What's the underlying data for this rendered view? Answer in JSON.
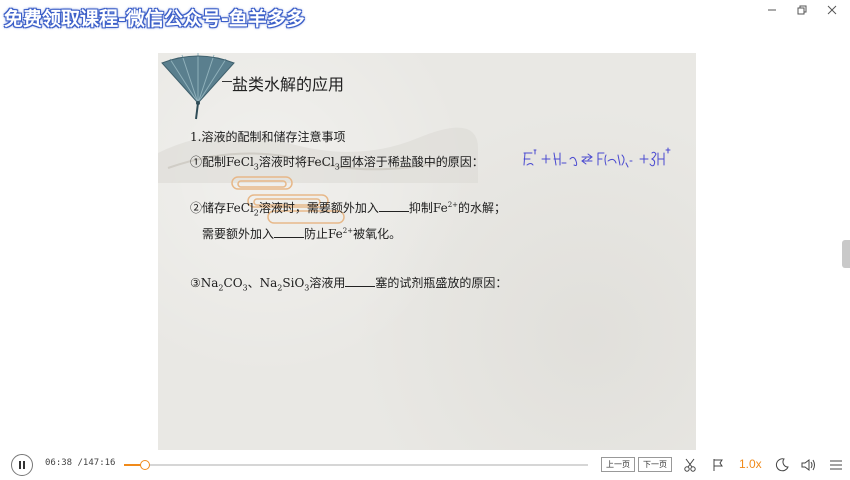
{
  "watermark": "免费领取课程-微信公众号-鱼羊多多",
  "slide": {
    "title": "盐类水解的应用",
    "section": "1.溶液的配制和储存注意事项",
    "item1": {
      "prefix": "①配制FeCl",
      "sub1": "3",
      "mid": "溶液时将FeCl",
      "sub2": "3",
      "suffix": "固体溶于稀盐酸中的原因："
    },
    "item2": {
      "prefix": "②储存FeCl",
      "sub1": "2",
      "mid": "溶液时，需要额外加入",
      "after_blank": "抑制Fe",
      "sup": "2+",
      "suffix": "的水解；"
    },
    "item2b": {
      "prefix": "需要额外加入",
      "after_blank": "防止Fe",
      "sup": "2+",
      "suffix": "被氧化。"
    },
    "item3": {
      "prefix": "③Na",
      "s1": "2",
      "t1": "CO",
      "s2": "3",
      "t2": "、Na",
      "s3": "2",
      "t3": "SiO",
      "s4": "3",
      "t4": "溶液用",
      "suffix": "塞的试剂瓶盛放的原因："
    },
    "handwriting_color": "#4a4ad0"
  },
  "player": {
    "current_time": "06:38",
    "total_time": "/147:16",
    "progress_fraction": 0.045,
    "prev_label": "上一页",
    "next_label": "下一页",
    "speed": "1.0x",
    "accent_color": "#f08a1a"
  }
}
